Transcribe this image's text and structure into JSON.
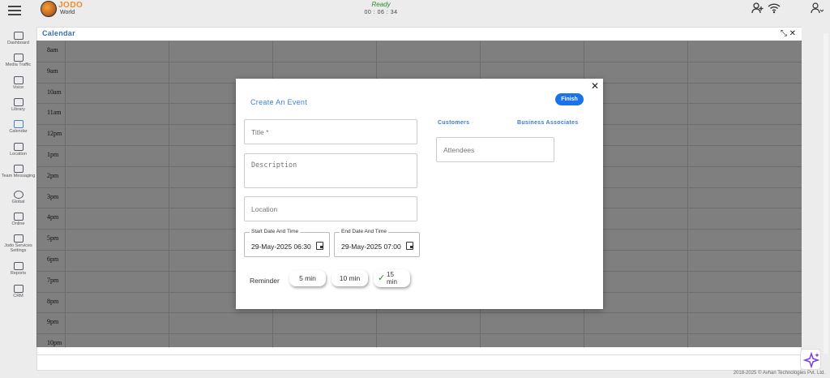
{
  "app": {
    "logo_line1": "JODO",
    "logo_line2": "World",
    "status": "Ready",
    "timer": "00 : 06 : 34"
  },
  "sidebar": {
    "items": [
      {
        "label": "Dashboard",
        "icon": "dashboard-icon"
      },
      {
        "label": "Media Traffic",
        "icon": "media-traffic-icon"
      },
      {
        "label": "Voice",
        "icon": "phone-icon"
      },
      {
        "label": "Library",
        "icon": "library-icon"
      },
      {
        "label": "Calendar",
        "icon": "calendar-icon"
      },
      {
        "label": "Location",
        "icon": "location-pin-icon"
      },
      {
        "label": "Team Messaging",
        "icon": "team-messaging-icon"
      },
      {
        "label": "Global",
        "icon": "globe-icon"
      },
      {
        "label": "Online",
        "icon": "online-icon"
      },
      {
        "label": "Jodo Services Settings",
        "icon": "settings-icon"
      },
      {
        "label": "Reports",
        "icon": "reports-icon"
      },
      {
        "label": "CRM",
        "icon": "crm-icon"
      }
    ]
  },
  "calendar": {
    "title": "Calendar",
    "hours": [
      "8am",
      "9am",
      "10am",
      "11am",
      "12pm",
      "1pm",
      "2pm",
      "3pm",
      "4pm",
      "5pm",
      "6pm",
      "7pm",
      "8pm",
      "9pm",
      "10pm"
    ]
  },
  "modal": {
    "title": "Create An Event",
    "finish": "Finish",
    "title_placeholder": "Title *",
    "description_placeholder": "Description",
    "location_placeholder": "Location",
    "start_label": "Start Date And Time",
    "start_value": "29-May-2025 06:30",
    "end_label": "End Date And Time",
    "end_value": "29-May-2025 07:00",
    "reminder_label": "Reminder",
    "reminders": [
      "5 min",
      "10 min",
      "15 min"
    ],
    "selected_reminder": "15 min",
    "tab_customers": "Customers",
    "tab_associates": "Business Associates",
    "attendees_placeholder": "Attendees"
  },
  "footer": {
    "copyright": "2018-2025 © Avhan Technologies Pvt. Ltd."
  }
}
